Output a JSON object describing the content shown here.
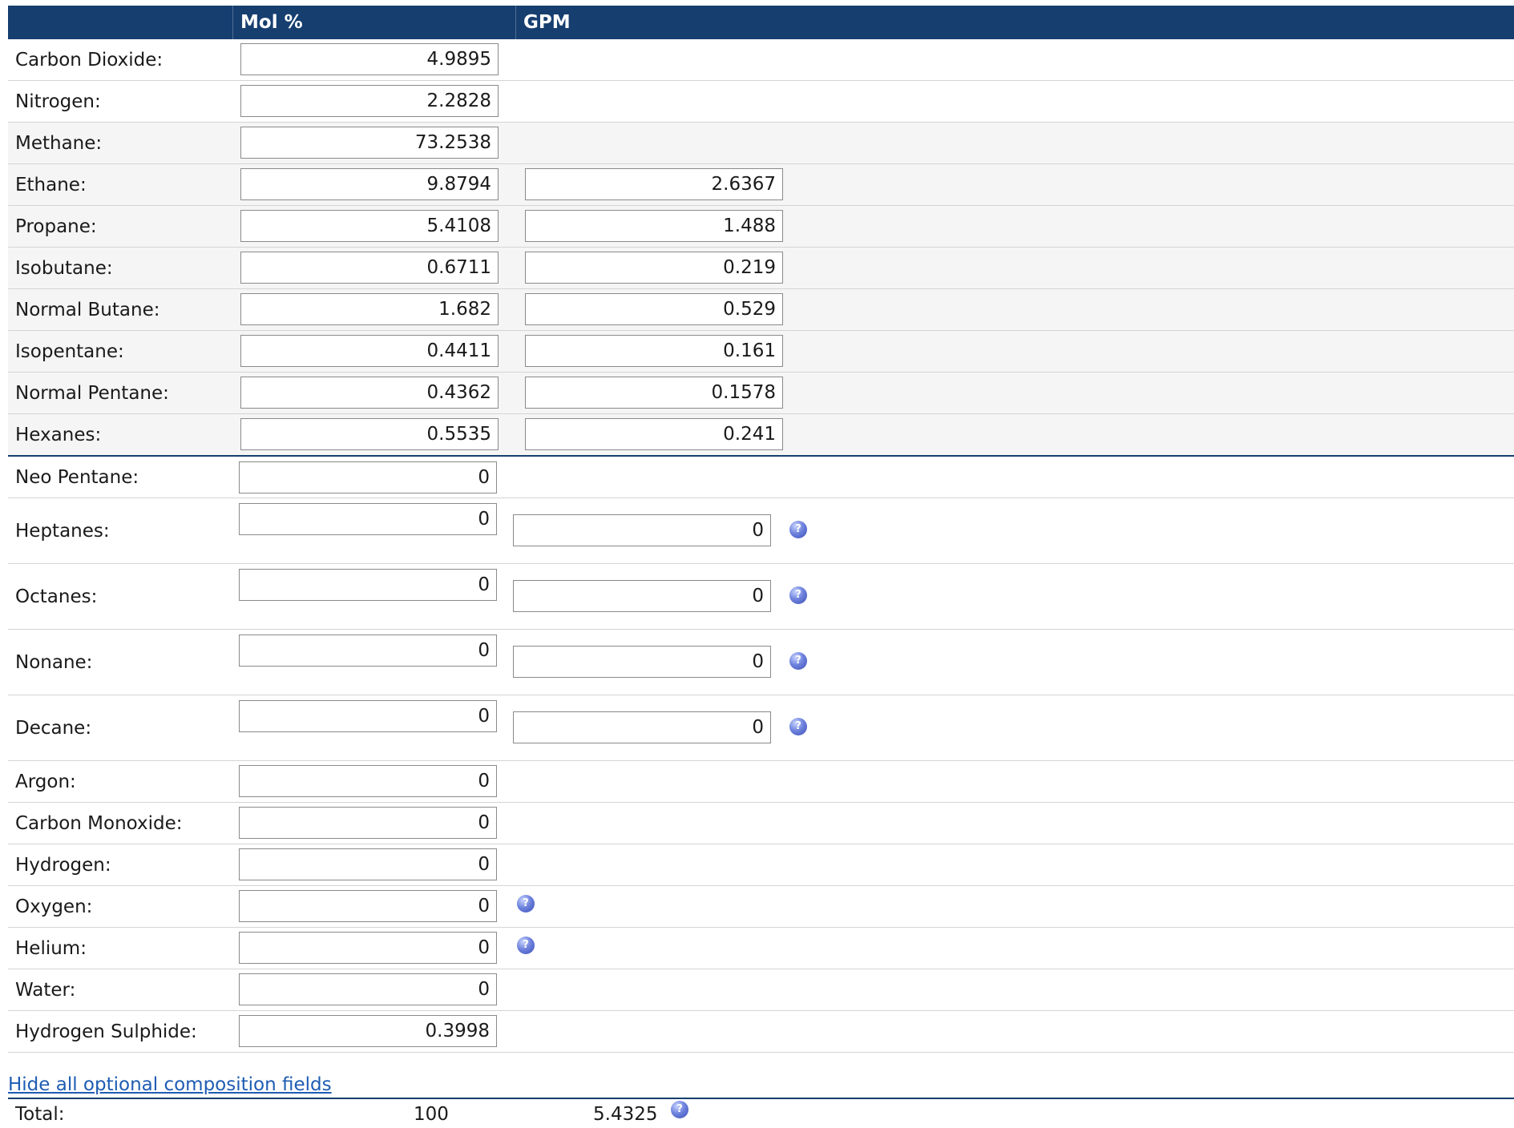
{
  "header": {
    "col_mol": "Mol %",
    "col_gpm": "GPM"
  },
  "rows": [
    {
      "label": "Carbon Dioxide:",
      "mol": "4.9895"
    },
    {
      "label": "Nitrogen:",
      "mol": "2.2828"
    },
    {
      "label": "Methane:",
      "mol": "73.2538"
    },
    {
      "label": "Ethane:",
      "mol": "9.8794",
      "gpm": "2.6367"
    },
    {
      "label": "Propane:",
      "mol": "5.4108",
      "gpm": "1.488"
    },
    {
      "label": "Isobutane:",
      "mol": "0.6711",
      "gpm": "0.219"
    },
    {
      "label": "Normal Butane:",
      "mol": "1.682",
      "gpm": "0.529"
    },
    {
      "label": "Isopentane:",
      "mol": "0.4411",
      "gpm": "0.161"
    },
    {
      "label": "Normal Pentane:",
      "mol": "0.4362",
      "gpm": "0.1578"
    },
    {
      "label": "Hexanes:",
      "mol": "0.5535",
      "gpm": "0.241"
    },
    {
      "label": "Neo Pentane:",
      "mol": "0"
    },
    {
      "label": "Heptanes:",
      "mol": "0",
      "gpm": "0"
    },
    {
      "label": "Octanes:",
      "mol": "0",
      "gpm": "0"
    },
    {
      "label": "Nonane:",
      "mol": "0",
      "gpm": "0"
    },
    {
      "label": "Decane:",
      "mol": "0",
      "gpm": "0"
    },
    {
      "label": "Argon:",
      "mol": "0"
    },
    {
      "label": "Carbon Monoxide:",
      "mol": "0"
    },
    {
      "label": "Hydrogen:",
      "mol": "0"
    },
    {
      "label": "Oxygen:",
      "mol": "0"
    },
    {
      "label": "Helium:",
      "mol": "0"
    },
    {
      "label": "Water:",
      "mol": "0"
    },
    {
      "label": "Hydrogen Sulphide:",
      "mol": "0.3998"
    }
  ],
  "footer": {
    "toggle_link": "Hide all optional composition fields",
    "total_label": "Total:",
    "total_mol": "100",
    "total_gpm": "5.4325"
  },
  "icons": {
    "help": "help-icon",
    "help_glyph": "?"
  },
  "colors": {
    "header_bg": "#163e6f",
    "link": "#1e5cb3",
    "help_icon": "#5a6fd0"
  }
}
